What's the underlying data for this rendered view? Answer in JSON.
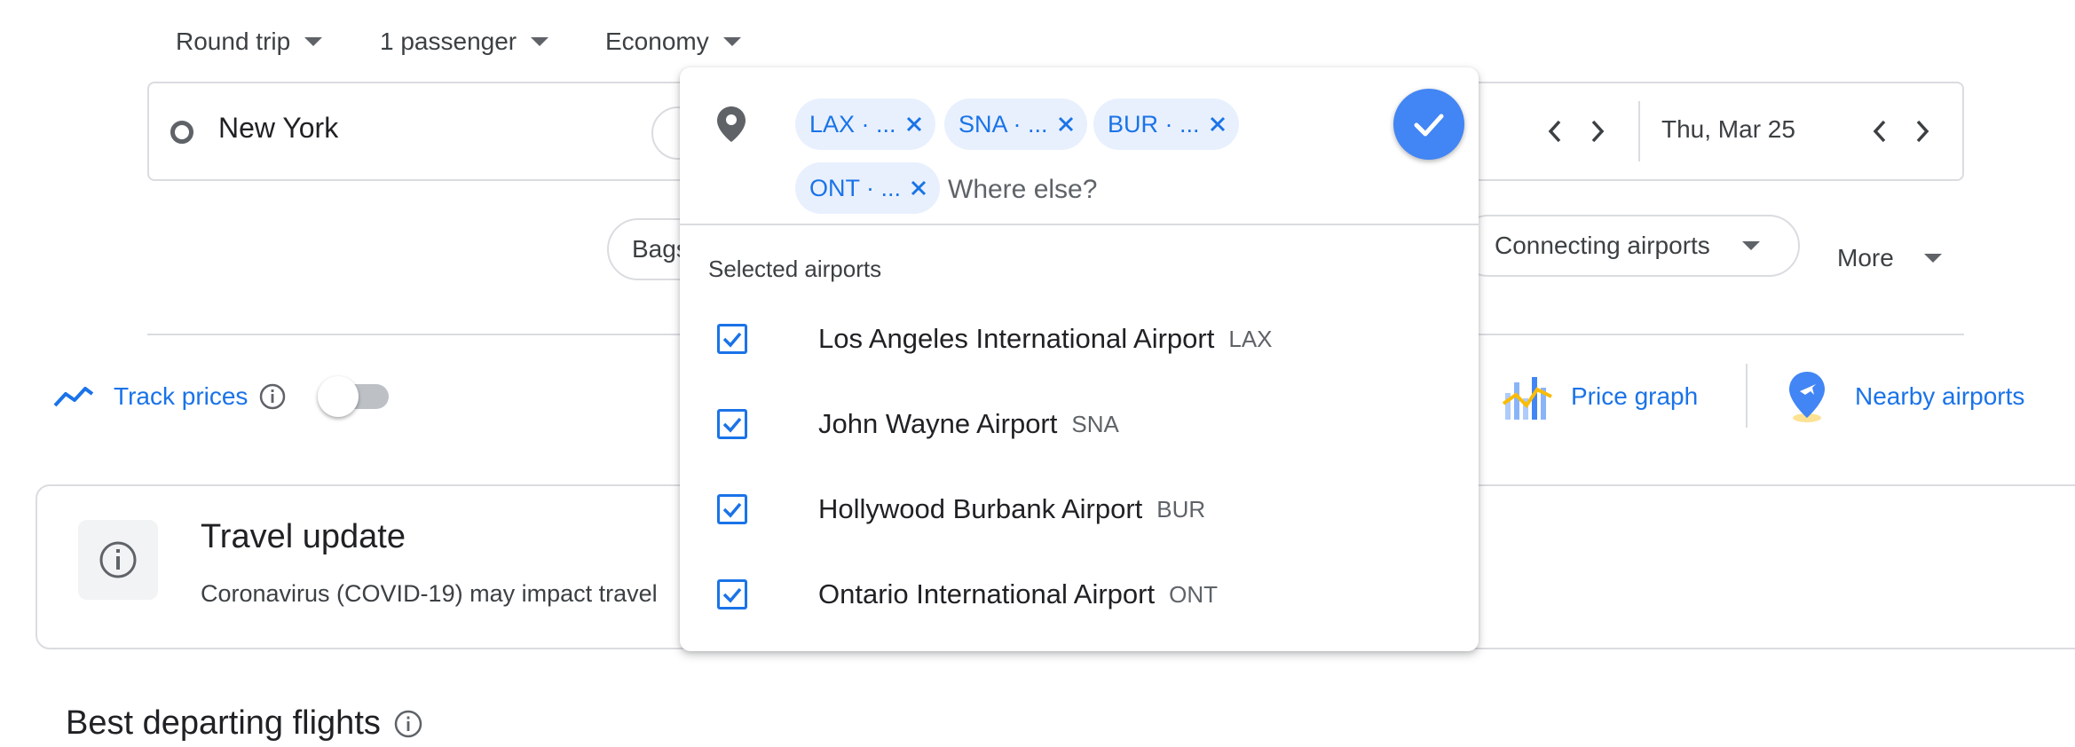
{
  "trip_options": {
    "trip_type": "Round trip",
    "passengers": "1 passenger",
    "cabin_class": "Economy"
  },
  "search": {
    "origin": "New York",
    "return_date": "Thu, Mar 25"
  },
  "destination_picker": {
    "chips": [
      {
        "label": "LAX · ..."
      },
      {
        "label": "SNA · ..."
      },
      {
        "label": "BUR · ..."
      },
      {
        "label": "ONT · ..."
      }
    ],
    "input_placeholder": "Where else?",
    "section_label": "Selected airports",
    "airports": [
      {
        "name": "Los Angeles International Airport",
        "code": "LAX",
        "checked": true
      },
      {
        "name": "John Wayne Airport",
        "code": "SNA",
        "checked": true
      },
      {
        "name": "Hollywood Burbank Airport",
        "code": "BUR",
        "checked": true
      },
      {
        "name": "Ontario International Airport",
        "code": "ONT",
        "checked": true
      }
    ]
  },
  "filters": {
    "bags_partial": "Bags",
    "connecting_airports": "Connecting airports",
    "more": "More"
  },
  "tools": {
    "track_prices": "Track prices",
    "track_prices_enabled": false,
    "price_graph": "Price graph",
    "nearby_airports": "Nearby airports"
  },
  "travel_update": {
    "title": "Travel update",
    "body_visible": "Coronavirus (COVID-19) may impact travel"
  },
  "results": {
    "heading": "Best departing flights"
  },
  "colors": {
    "accent": "#1a73e8",
    "confirm_button": "#4285f4",
    "chip_bg": "#e8f0fe",
    "border": "#dadce0"
  }
}
